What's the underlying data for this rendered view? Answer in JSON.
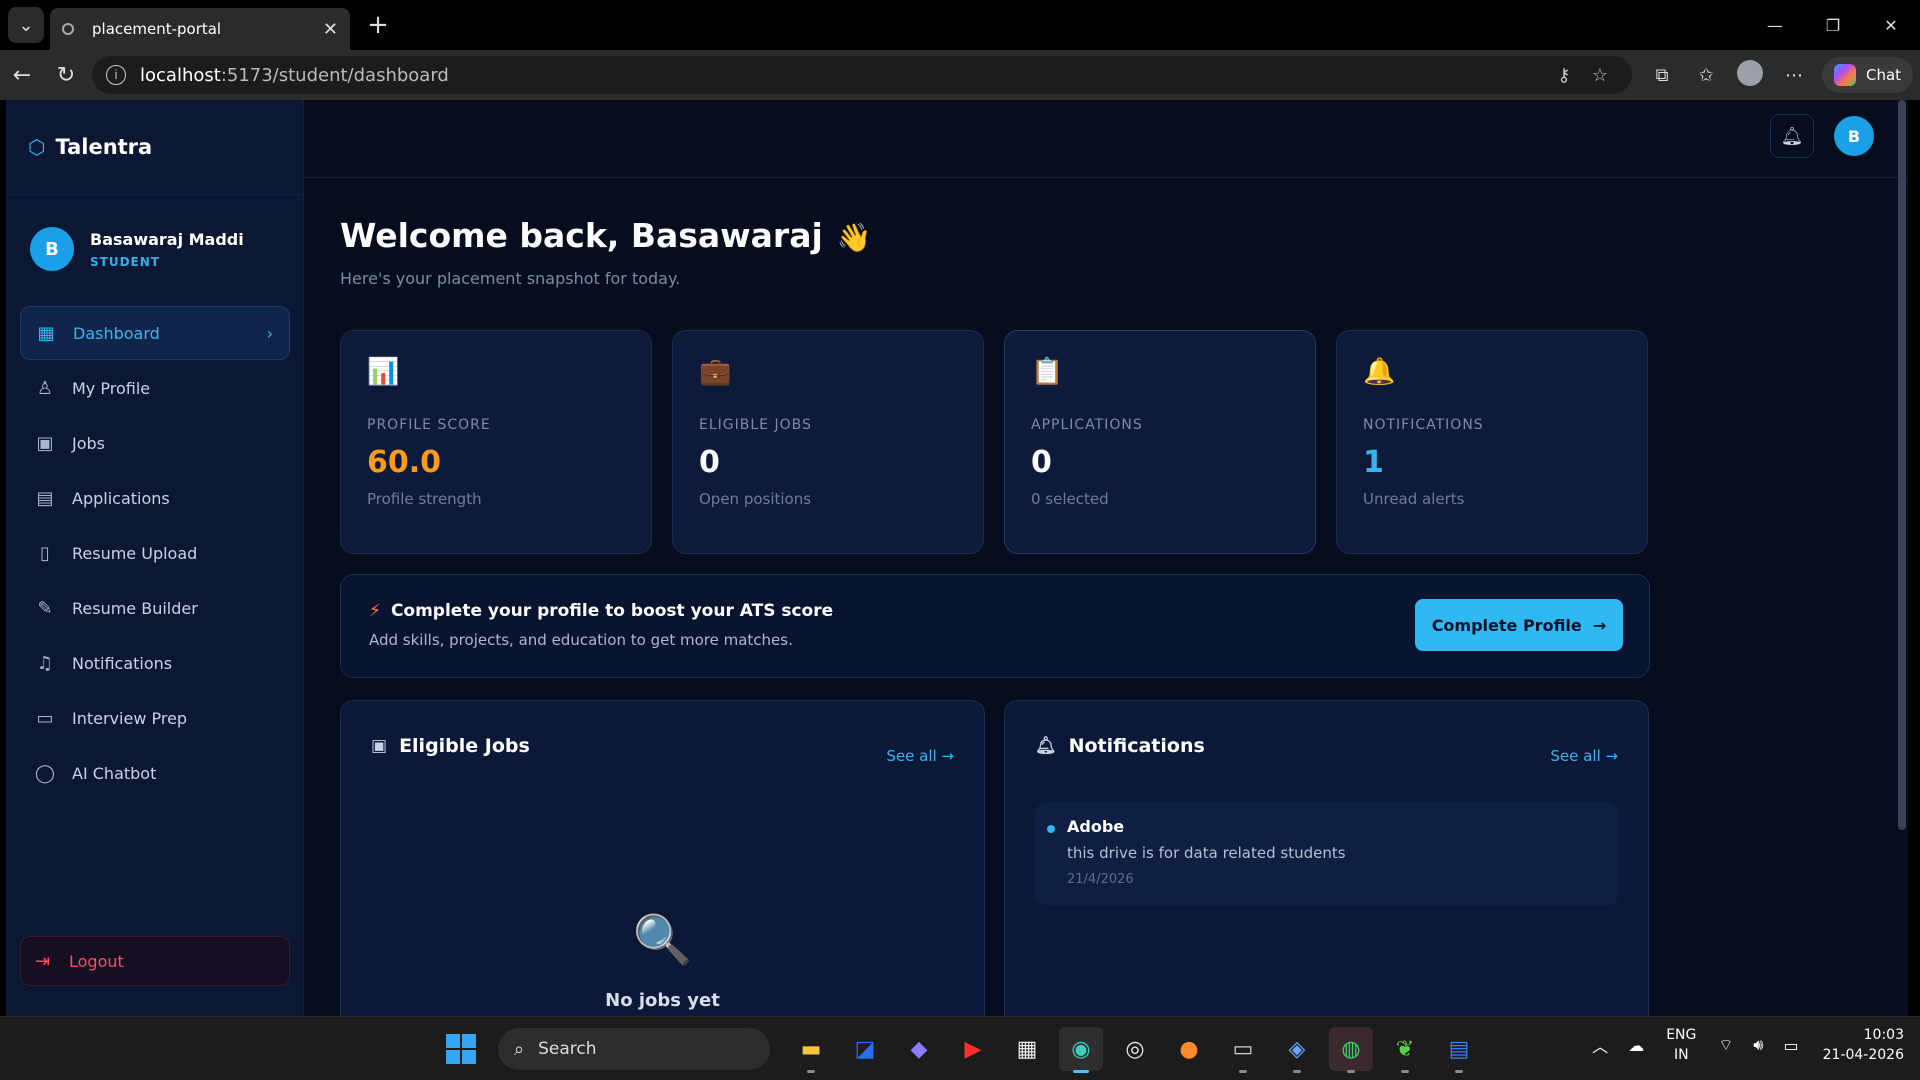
{
  "browser": {
    "tab_title": "placement-portal",
    "url_host": "localhost",
    "url_rest": ":5173/student/dashboard",
    "chat_label": "Chat"
  },
  "app": {
    "brand": "Talentra",
    "user": {
      "initial": "B",
      "name": "Basawaraj Maddi",
      "role": "STUDENT"
    },
    "nav": [
      {
        "label": "Dashboard",
        "icon": "grid-icon",
        "active": true
      },
      {
        "label": "My Profile",
        "icon": "user-icon"
      },
      {
        "label": "Jobs",
        "icon": "briefcase-icon"
      },
      {
        "label": "Applications",
        "icon": "clipboard-icon"
      },
      {
        "label": "Resume Upload",
        "icon": "file-icon"
      },
      {
        "label": "Resume Builder",
        "icon": "pen-icon"
      },
      {
        "label": "Notifications",
        "icon": "bell-icon"
      },
      {
        "label": "Interview Prep",
        "icon": "book-icon"
      },
      {
        "label": "AI Chatbot",
        "icon": "chat-icon"
      }
    ],
    "logout_label": "Logout",
    "top_avatar": "B"
  },
  "dashboard": {
    "welcome": "Welcome back, Basawaraj",
    "subtitle": "Here's your placement snapshot for today.",
    "stats": [
      {
        "label": "PROFILE SCORE",
        "value": "60.0",
        "sub": "Profile strength",
        "icon": "bar-chart-icon"
      },
      {
        "label": "ELIGIBLE JOBS",
        "value": "0",
        "sub": "Open positions",
        "icon": "briefcase-icon"
      },
      {
        "label": "APPLICATIONS",
        "value": "0",
        "sub": "0 selected",
        "icon": "clipboard-icon"
      },
      {
        "label": "NOTIFICATIONS",
        "value": "1",
        "sub": "Unread alerts",
        "icon": "bell-icon"
      }
    ],
    "banner": {
      "title": "Complete your profile to boost your ATS score",
      "subtitle": "Add skills, projects, and education to get more matches.",
      "cta": "Complete Profile"
    },
    "eligible_jobs": {
      "title": "Eligible Jobs",
      "see_all": "See all →",
      "empty_text": "No jobs yet"
    },
    "notifications": {
      "title": "Notifications",
      "see_all": "See all →",
      "items": [
        {
          "title": "Adobe",
          "body": "this drive is for data related students",
          "date": "21/4/2026"
        }
      ]
    }
  },
  "taskbar": {
    "search_label": "Search",
    "lang": "ENG",
    "region": "IN",
    "time": "10:03",
    "date": "21-04-2026"
  }
}
